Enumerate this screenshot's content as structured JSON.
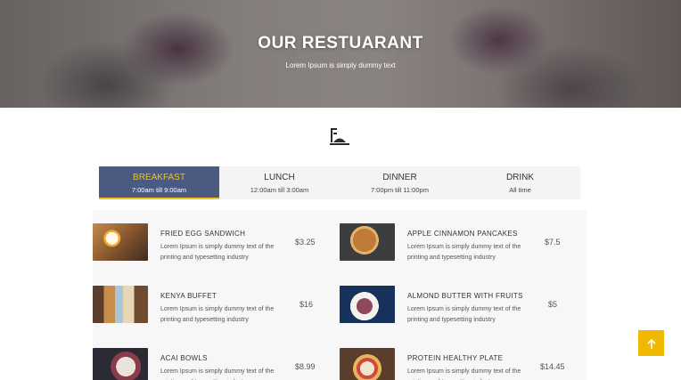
{
  "hero": {
    "title": "OUR RESTUARANT",
    "subtitle": "Lorem Ipsum is simply dummy text"
  },
  "tabs": [
    {
      "name": "BREAKFAST",
      "time": "7:00am till 9:00am",
      "active": true
    },
    {
      "name": "LUNCH",
      "time": "12:00am till 3:00am",
      "active": false
    },
    {
      "name": "DINNER",
      "time": "7:00pm till 11:00pm",
      "active": false
    },
    {
      "name": "DRINK",
      "time": "All time",
      "active": false
    }
  ],
  "menu_items": [
    {
      "name": "FRIED EGG SANDWICH",
      "desc": "Lorem Ipsum is simply dummy text of the printing and typesetting industry",
      "price": "$3.25",
      "icon": "fried-egg-sandwich-photo"
    },
    {
      "name": "APPLE CINNAMON PANCAKES",
      "desc": "Lorem Ipsum is simply dummy text of the printing and typesetting industry",
      "price": "$7.5",
      "icon": "pancakes-photo"
    },
    {
      "name": "KENYA BUFFET",
      "desc": "Lorem Ipsum is simply dummy text of the printing and typesetting industry",
      "price": "$16",
      "icon": "buffet-photo"
    },
    {
      "name": "ALMOND BUTTER WITH FRUITS",
      "desc": "Lorem Ipsum is simply dummy text of the printing and typesetting industry",
      "price": "$5",
      "icon": "fruit-bowl-photo"
    },
    {
      "name": "ACAI BOWLS",
      "desc": "Lorem Ipsum is simply dummy text of the printing and typesetting industry",
      "price": "$8.99",
      "icon": "acai-bowl-photo"
    },
    {
      "name": "PROTEIN HEALTHY PLATE",
      "desc": "Lorem Ipsum is simply dummy text of the printing and typesetting industry",
      "price": "$14.45",
      "icon": "protein-plate-photo"
    }
  ],
  "colors": {
    "active_tab_bg": "#4a5a80",
    "accent": "#f0c419",
    "back_to_top": "#f0b800"
  },
  "icons": {
    "menu_icon": "serving-dish-icon",
    "back_to_top": "arrow-up-icon"
  }
}
